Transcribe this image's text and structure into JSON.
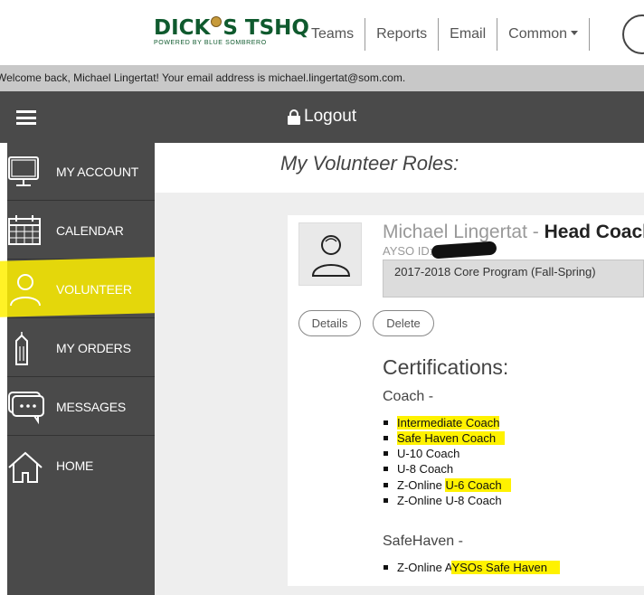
{
  "header": {
    "logo_text_a": "DICK",
    "logo_text_b": "S TSHQ",
    "logo_sub": "POWERED BY BLUE SOMBRERO",
    "nav": [
      "Teams",
      "Reports",
      "Email",
      "Common"
    ]
  },
  "welcome_text": "Welcome back, Michael Lingertat! Your email address is michael.lingertat@som.com.",
  "topbar": {
    "logout_label": "Logout"
  },
  "sidebar": {
    "items": [
      {
        "label": "MY ACCOUNT",
        "icon": "monitor-icon"
      },
      {
        "label": "CALENDAR",
        "icon": "calendar-icon"
      },
      {
        "label": "VOLUNTEER",
        "icon": "person-icon",
        "active": true
      },
      {
        "label": "MY ORDERS",
        "icon": "tag-icon"
      },
      {
        "label": "MESSAGES",
        "icon": "chat-icon"
      },
      {
        "label": "HOME",
        "icon": "home-icon"
      }
    ]
  },
  "main": {
    "title": "My Volunteer Roles:",
    "role": {
      "name": "Michael Lingertat - ",
      "role": "Head Coach",
      "ayso_label": "AYSO ID:",
      "program": "2017-2018 Core Program (Fall-Spring)",
      "details_label": "Details",
      "delete_label": "Delete"
    },
    "certifications": {
      "title": "Certifications:",
      "coach_label": "Coach -",
      "coach_items": [
        {
          "pre": "",
          "hl": "Intermediate Coach",
          "post": ""
        },
        {
          "pre": "",
          "hl": "Safe Haven Coach",
          "post": ""
        },
        {
          "pre": "U-10 Coach",
          "hl": "",
          "post": ""
        },
        {
          "pre": "U-8 Coach",
          "hl": "",
          "post": ""
        },
        {
          "pre": "Z-Online ",
          "hl": "U-6 Coach",
          "post": ""
        },
        {
          "pre": "Z-Online U-8 Coach",
          "hl": "",
          "post": ""
        }
      ],
      "safehaven_label": "SafeHaven -",
      "safehaven_items": [
        {
          "pre": "Z-Online A",
          "hl": "YSOs Safe Haven",
          "post": ""
        }
      ]
    }
  },
  "colors": {
    "dark_bar": "#4a4a4a",
    "highlight": "#fff200",
    "brand_green": "#0f5a2e"
  }
}
